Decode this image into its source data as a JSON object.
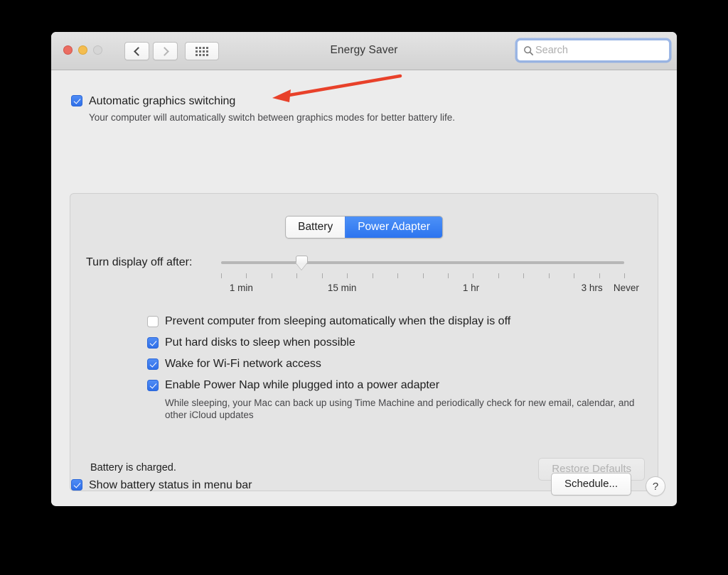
{
  "window": {
    "title": "Energy Saver",
    "traffic_lights": [
      "close",
      "minimize",
      "zoom"
    ],
    "nav": {
      "back": "back-chevron",
      "forward": "forward-chevron",
      "grid": "show-all-grid"
    },
    "search": {
      "placeholder": "Search",
      "value": "",
      "icon": "search-icon"
    }
  },
  "auto_graphics": {
    "label": "Automatic graphics switching",
    "checked": true,
    "description": "Your computer will automatically switch between graphics modes for better battery life."
  },
  "segmented": {
    "options": [
      {
        "label": "Battery",
        "selected": false
      },
      {
        "label": "Power Adapter",
        "selected": true
      }
    ]
  },
  "slider": {
    "label": "Turn display off after:",
    "value_percent": 20,
    "tick_count": 17,
    "tick_labels": [
      {
        "text": "1 min",
        "percent": 5
      },
      {
        "text": "15 min",
        "percent": 30
      },
      {
        "text": "1 hr",
        "percent": 62
      },
      {
        "text": "3 hrs",
        "percent": 92
      },
      {
        "text": "Never",
        "percent": 100
      }
    ]
  },
  "options": [
    {
      "label": "Prevent computer from sleeping automatically when the display is off",
      "checked": false
    },
    {
      "label": "Put hard disks to sleep when possible",
      "checked": true
    },
    {
      "label": "Wake for Wi-Fi network access",
      "checked": true
    },
    {
      "label": "Enable Power Nap while plugged into a power adapter",
      "checked": true,
      "description": "While sleeping, your Mac can back up using Time Machine and periodically check for new email, calendar, and other iCloud updates"
    }
  ],
  "battery_status": "Battery is charged.",
  "restore_defaults": {
    "label": "Restore Defaults",
    "disabled": true
  },
  "footer": {
    "show_battery": {
      "label": "Show battery status in menu bar",
      "checked": true
    },
    "schedule": "Schedule...",
    "help": "?"
  },
  "annotation": {
    "type": "arrow",
    "color": "#E8412A",
    "direction": "left",
    "target": "Automatic graphics switching"
  },
  "colors": {
    "accent_blue": "#2f6fe8",
    "window_bg": "#ececec",
    "panel_bg": "#e4e4e4",
    "annotation_red": "#E8412A"
  }
}
